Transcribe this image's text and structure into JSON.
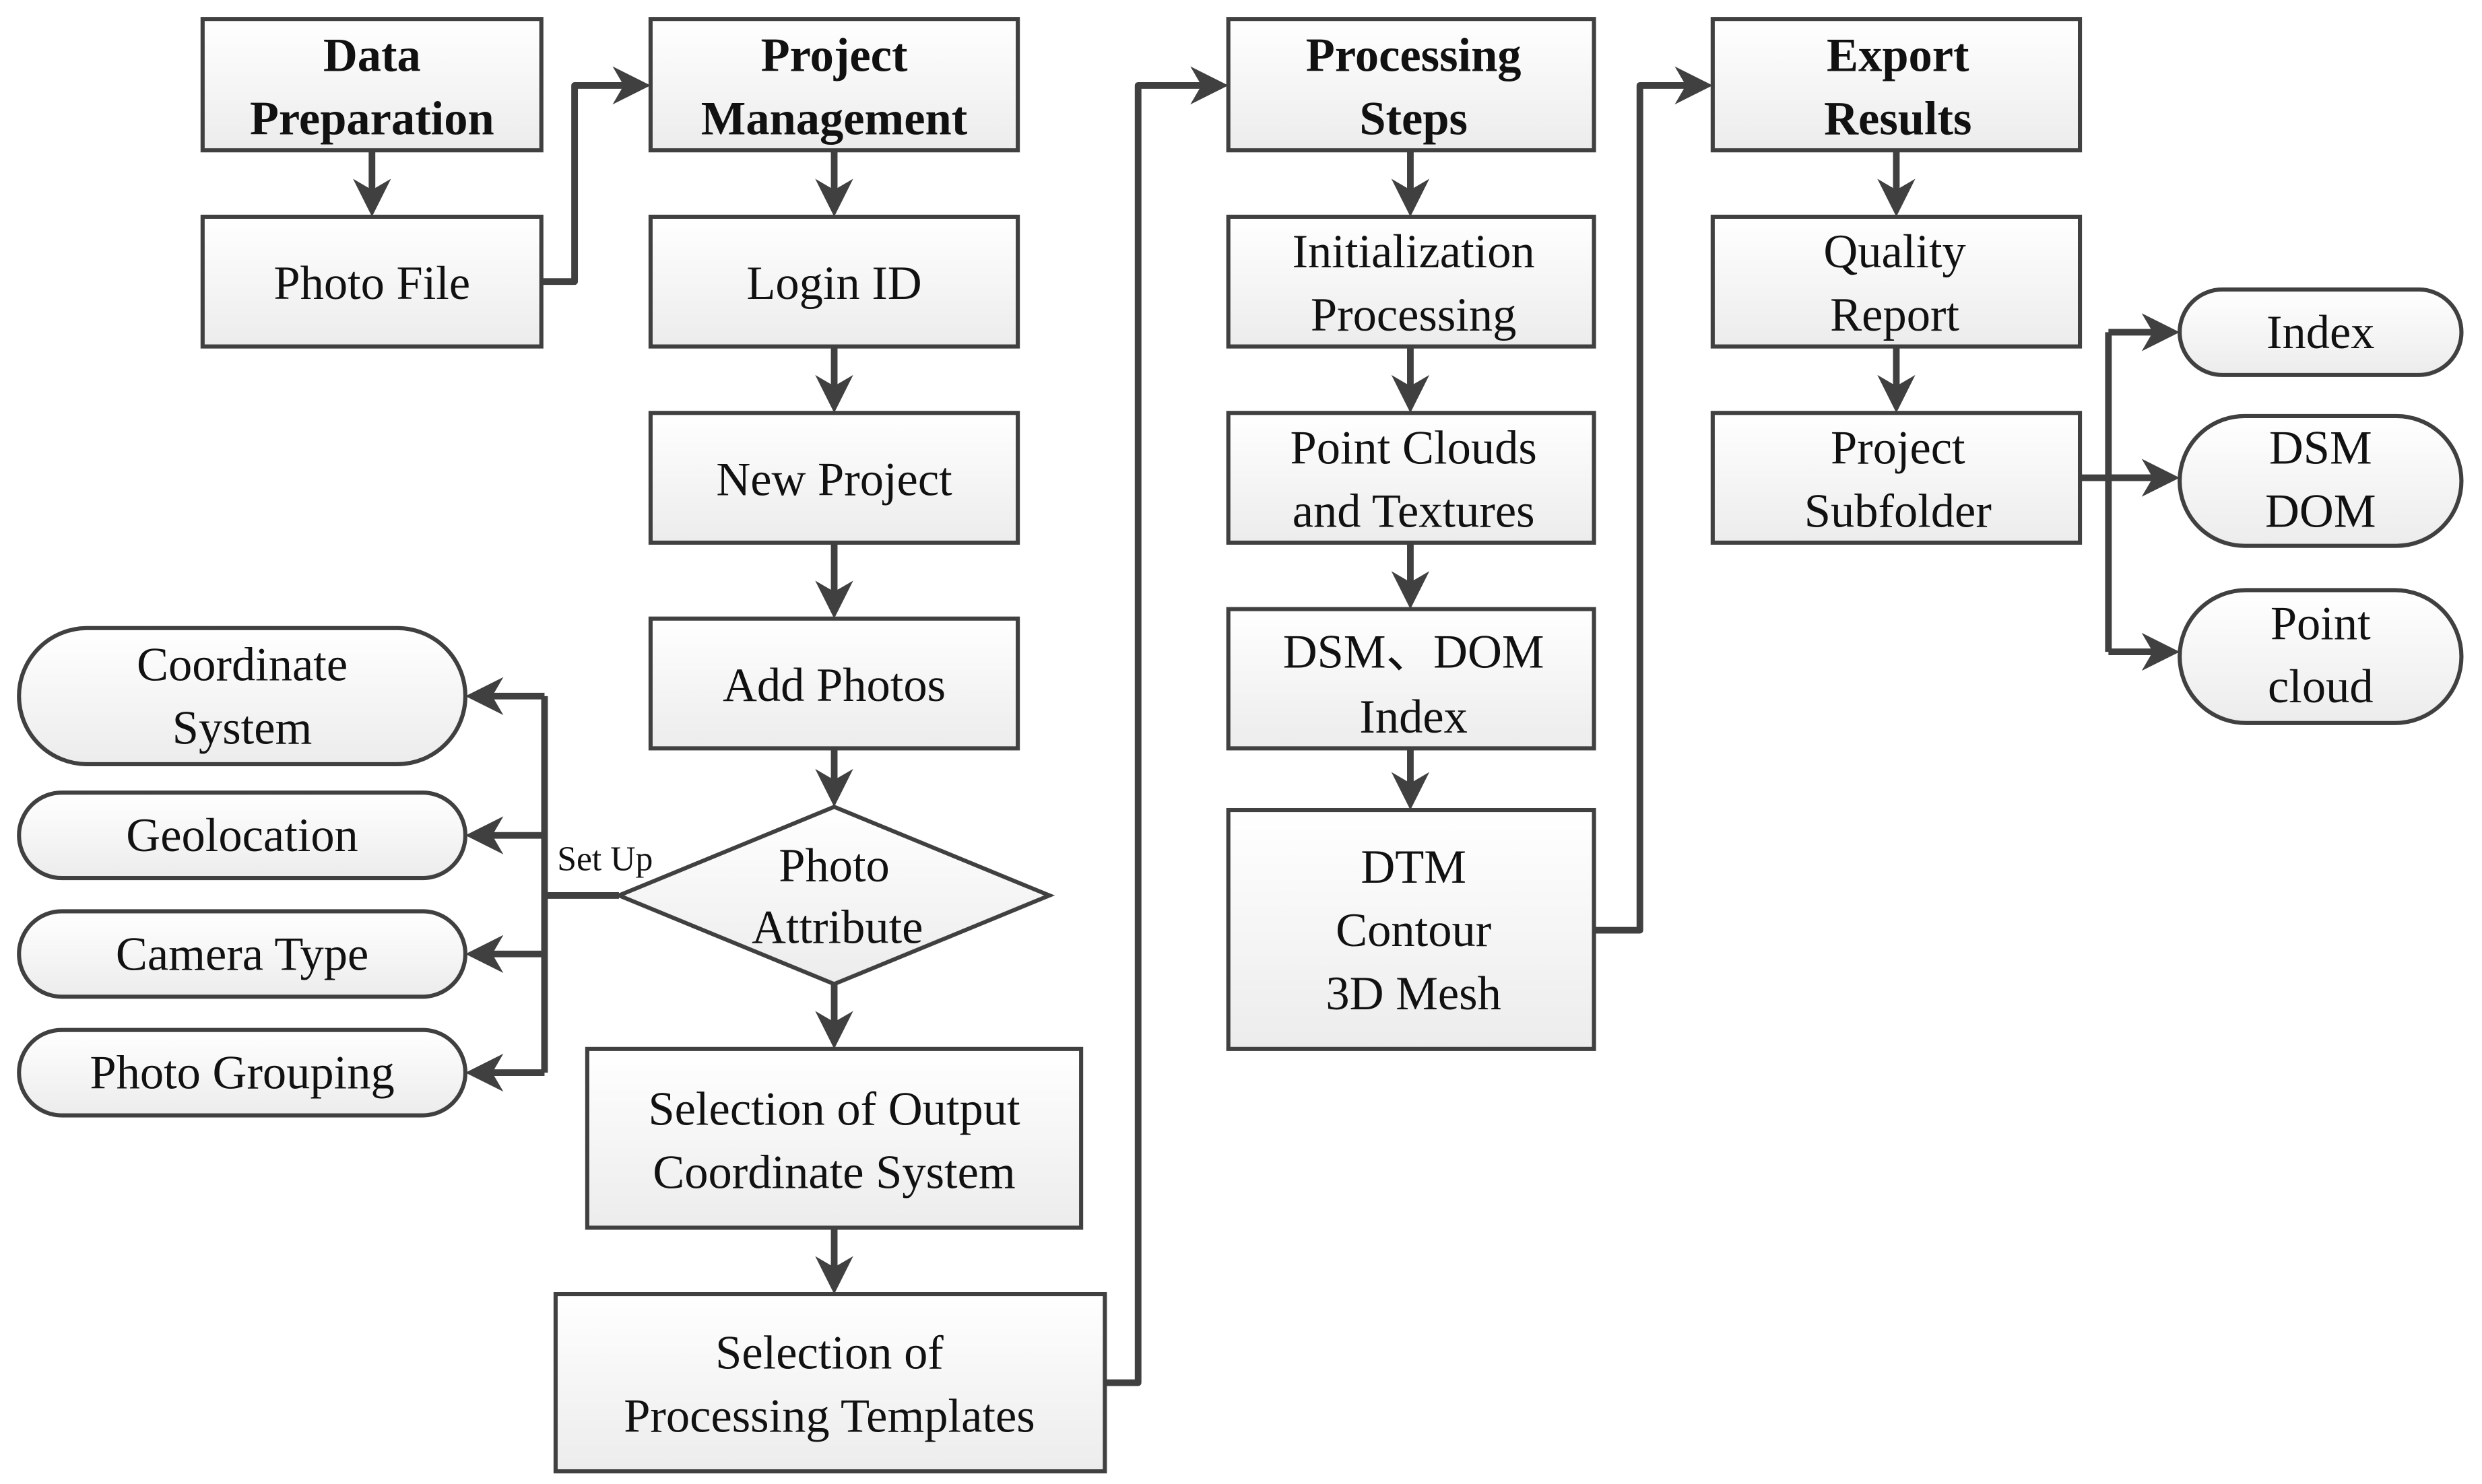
{
  "diagram": {
    "type": "flowchart",
    "columns": {
      "data_preparation": {
        "header": [
          "Data",
          "Preparation"
        ],
        "steps": [
          {
            "id": "photo_file",
            "lines": [
              "Photo File"
            ]
          }
        ]
      },
      "project_management": {
        "header": [
          "Project",
          "Management"
        ],
        "steps": [
          {
            "id": "login_id",
            "lines": [
              "Login ID"
            ]
          },
          {
            "id": "new_project",
            "lines": [
              "New Project"
            ]
          },
          {
            "id": "add_photos",
            "lines": [
              "Add Photos"
            ]
          },
          {
            "id": "photo_attribute",
            "shape": "diamond",
            "lines": [
              "Photo",
              "Attribute"
            ]
          },
          {
            "id": "output_coord",
            "lines": [
              "Selection of Output",
              "Coordinate System"
            ]
          },
          {
            "id": "proc_templates",
            "lines": [
              "Selection of",
              "Processing Templates"
            ]
          }
        ]
      },
      "processing_steps": {
        "header": [
          "Processing",
          "Steps"
        ],
        "steps": [
          {
            "id": "init_processing",
            "lines": [
              "Initialization",
              "Processing"
            ]
          },
          {
            "id": "point_clouds",
            "lines": [
              "Point Clouds",
              "and Textures"
            ]
          },
          {
            "id": "dsm_dom_index",
            "lines": [
              "DSM、DOM",
              "Index"
            ]
          },
          {
            "id": "dtm_contour_mesh",
            "lines": [
              "DTM",
              "Contour",
              "3D Mesh"
            ]
          }
        ]
      },
      "export_results": {
        "header": [
          "Export",
          "Results"
        ],
        "steps": [
          {
            "id": "quality_report",
            "lines": [
              "Quality",
              "Report"
            ]
          },
          {
            "id": "project_subfolder",
            "lines": [
              "Project",
              "Subfolder"
            ]
          }
        ]
      }
    },
    "setup_options": {
      "edge_label": "Set Up",
      "items": [
        {
          "id": "coordinate_system",
          "lines": [
            "Coordinate",
            "System"
          ]
        },
        {
          "id": "geolocation",
          "lines": [
            "Geolocation"
          ]
        },
        {
          "id": "camera_type",
          "lines": [
            "Camera Type"
          ]
        },
        {
          "id": "photo_grouping",
          "lines": [
            "Photo Grouping"
          ]
        }
      ]
    },
    "subfolder_outputs": {
      "items": [
        {
          "id": "index",
          "lines": [
            "Index"
          ]
        },
        {
          "id": "dsm_dom",
          "lines": [
            "DSM",
            "DOM"
          ]
        },
        {
          "id": "point_cloud",
          "lines": [
            "Point",
            "cloud"
          ]
        }
      ]
    },
    "colors": {
      "stroke": "#404040",
      "fill_top": "#ffffff",
      "fill_bottom": "#efefef",
      "text": "#111111"
    }
  }
}
